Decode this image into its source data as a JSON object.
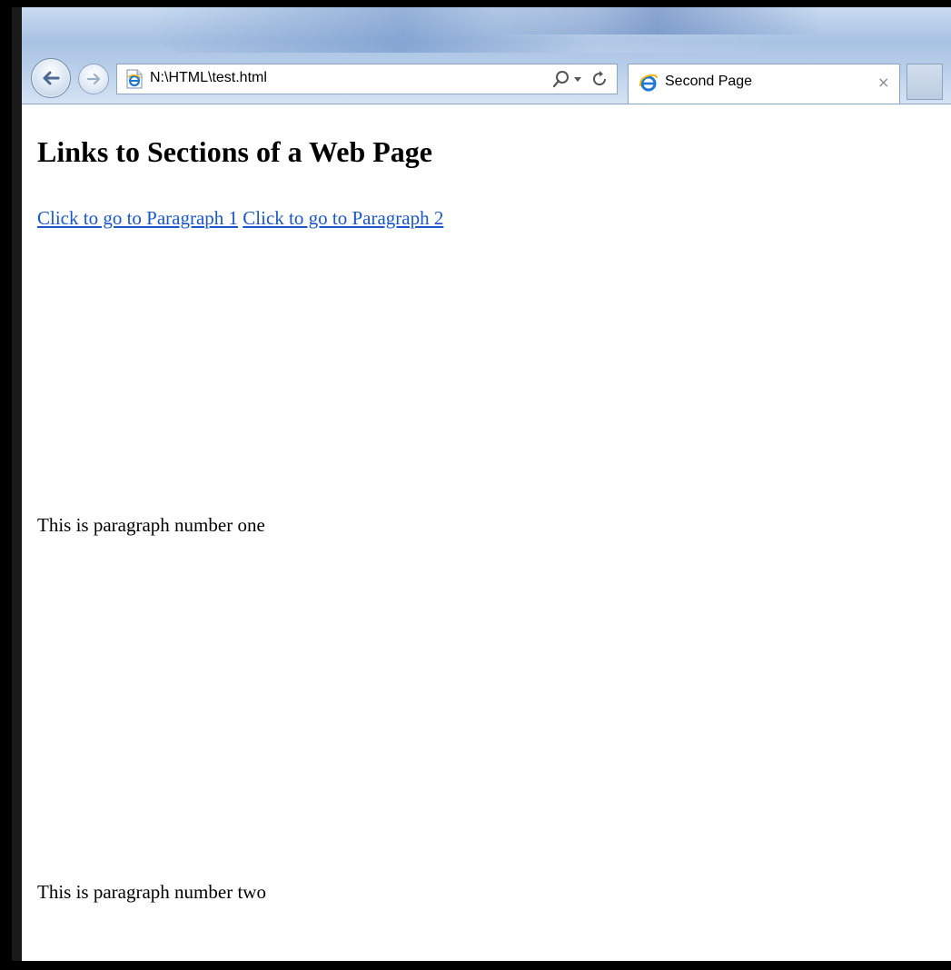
{
  "browser": {
    "address": "N:\\HTML\\test.html",
    "tab": {
      "title": "Second Page",
      "close_symbol": "×"
    },
    "icons": {
      "back": "back-arrow-icon",
      "forward": "forward-arrow-icon",
      "page": "ie-page-icon",
      "search": "search-icon",
      "dropdown": "chevron-down-icon",
      "refresh": "refresh-icon",
      "tab": "ie-logo-icon",
      "close": "close-icon"
    }
  },
  "page": {
    "heading": "Links to Sections of a Web Page",
    "links": [
      {
        "label": "Click to go to Paragraph 1"
      },
      {
        "label": "Click to go to Paragraph 2"
      }
    ],
    "paragraphs": [
      {
        "text": "This is paragraph number one"
      },
      {
        "text": "This is paragraph number two"
      }
    ]
  },
  "colors": {
    "link": "#1a56c9",
    "text": "#000000",
    "frame": "#000000"
  }
}
